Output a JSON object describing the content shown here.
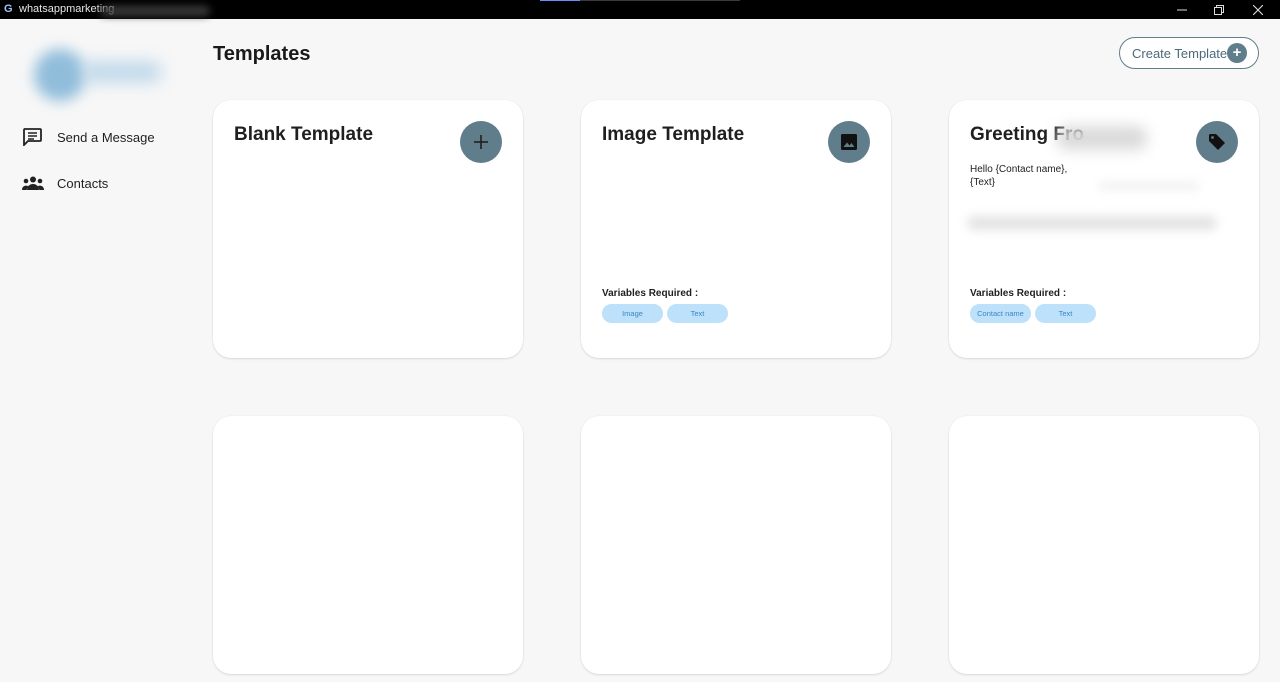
{
  "window": {
    "app_title": "whatsappmarketing",
    "app_icon_glyph": "G"
  },
  "sidebar": {
    "items": [
      {
        "label": "Send a Message",
        "icon": "message-icon"
      },
      {
        "label": "Contacts",
        "icon": "people-icon"
      }
    ]
  },
  "header": {
    "title": "Templates",
    "create_button_label": "Create Template",
    "create_button_glyph": "+"
  },
  "cards": [
    {
      "title": "Blank Template",
      "icon": "plus-icon"
    },
    {
      "title": "Image Template",
      "icon": "image-icon",
      "variables_label": "Variables Required :",
      "variables": [
        "Image",
        "Text"
      ]
    },
    {
      "title": "Greeting Fro",
      "icon": "tag-icon",
      "body_lines": [
        "Hello {Contact name},",
        "{Text}"
      ],
      "variables_label": "Variables Required :",
      "variables": [
        "Contact name",
        "Text"
      ]
    }
  ],
  "colors": {
    "accent": "#607d8b",
    "chip_bg": "#bde0fb",
    "chip_text": "#3d85c6",
    "page_bg": "#f7f7f7",
    "titlebar_bg": "#000000"
  }
}
